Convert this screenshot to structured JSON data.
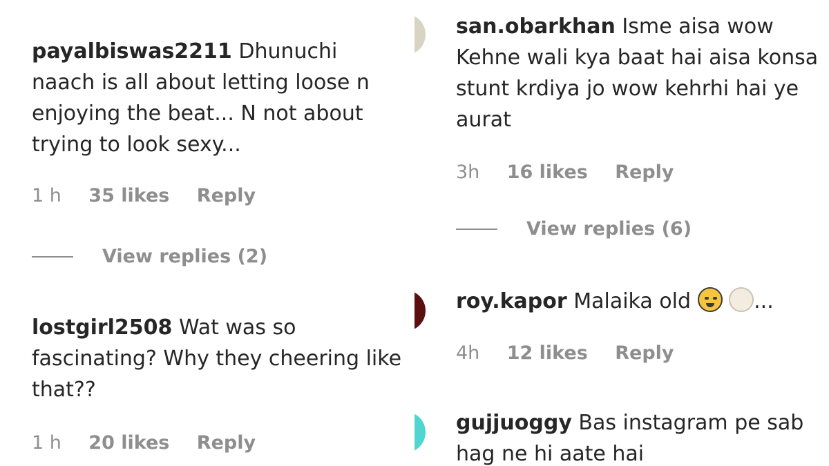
{
  "left_panel": {
    "comments": [
      {
        "username": "payalbiswas2211",
        "text": " Dhunuchi naach is all about letting loose n enjoying the beat... N not about trying to look sexy...",
        "time": "1 h",
        "likes": "35 likes",
        "reply": "Reply",
        "view_replies": "View replies (2)"
      },
      {
        "username": "lostgirl2508",
        "text": " Wat was so fascinating? Why they cheering like that??",
        "time": "1 h",
        "likes": "20 likes",
        "reply": "Reply"
      }
    ]
  },
  "right_panel": {
    "comments": [
      {
        "username": "san.obarkhan",
        "text": " Isme aisa wow Kehne wali kya baat hai aisa konsa stunt krdiya jo wow kehrhi hai ye aurat",
        "time": "3h",
        "likes": "16 likes",
        "reply": "Reply",
        "view_replies": "View replies (6)",
        "avatar_color": "#d9d3c3"
      },
      {
        "username": "roy.kapor",
        "text": " Malaika old ",
        "ellipsis": "...",
        "emojis": [
          "grimacing-face-emoji",
          "faded-face-emoji"
        ],
        "time": "4h",
        "likes": "12 likes",
        "reply": "Reply",
        "avatar_color": "#5b0f0f"
      },
      {
        "username": "gujjuoggy",
        "text": " Bas instagram pe sab hag ne hi aate hai",
        "avatar_color": "#4fd6d0"
      }
    ]
  }
}
